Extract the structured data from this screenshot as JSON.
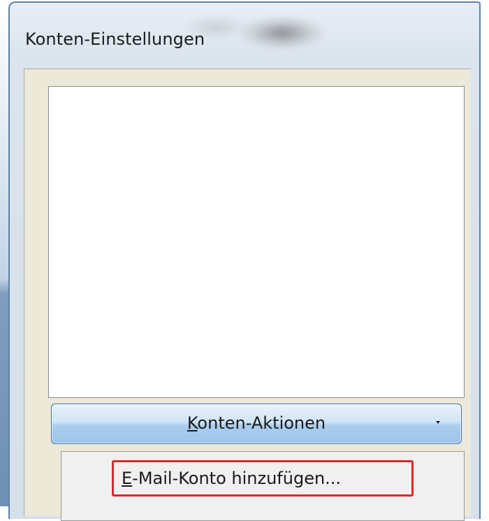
{
  "window": {
    "title": "Konten-Einstellungen"
  },
  "actions_button": {
    "label_accel": "K",
    "label_rest": "onten-Aktionen",
    "icon": "dropdown-arrow-icon"
  },
  "menu": {
    "items": [
      {
        "label_accel": "E",
        "label_rest": "-Mail-Konto hinzufügen...",
        "highlight_color": "#e1252b"
      }
    ]
  },
  "colors": {
    "window_border": "#5f7fa6",
    "client_bg": "#ece9d8",
    "button_border": "#3c6ea6",
    "highlight": "#e1252b"
  }
}
